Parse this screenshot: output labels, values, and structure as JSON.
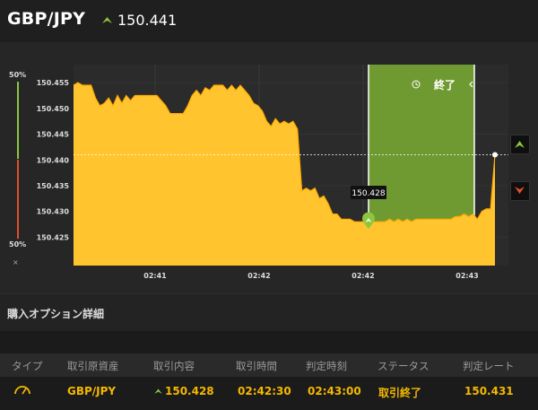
{
  "header": {
    "pair": "GBP/JPY",
    "price": "150.441",
    "trend_icon": "arrow-up-icon"
  },
  "meter": {
    "top_label": "50%",
    "bottom_label": "50%",
    "close_label": "×"
  },
  "chart": {
    "expiry_label": "終了",
    "entry_label": "150.428",
    "buttons": {
      "up_icon": "chevron-up-icon",
      "down_icon": "chevron-down-icon"
    }
  },
  "chart_data": {
    "type": "area",
    "y_ticks": [
      "150.455",
      "150.450",
      "150.445",
      "150.440",
      "150.435",
      "150.430",
      "150.425"
    ],
    "x_ticks": [
      "02:41",
      "02:42",
      "02:42",
      "02:43"
    ],
    "ylim": [
      150.4195,
      150.4585
    ],
    "current_value": 150.441,
    "entry_value": 150.428,
    "series": [
      {
        "values": [
          150.4545,
          150.455,
          150.4545,
          150.4545,
          150.4545,
          150.452,
          150.4505,
          150.451,
          150.452,
          150.4505,
          150.4525,
          150.451,
          150.4525,
          150.4515,
          150.4525,
          150.4525,
          150.4525,
          150.4525,
          150.4525,
          150.4525,
          150.4515,
          150.4505,
          150.449,
          150.449,
          150.449,
          150.449,
          150.4505,
          150.4525,
          150.4535,
          150.4525,
          150.454,
          150.4535,
          150.4545,
          150.4545,
          150.4545,
          150.4535,
          150.4545,
          150.4535,
          150.4545,
          150.4535,
          150.4525,
          150.451,
          150.4505,
          150.4495,
          150.4475,
          150.4465,
          150.448,
          150.447,
          150.4475,
          150.447,
          150.4475,
          150.446,
          150.434,
          150.4345,
          150.434,
          150.4345,
          150.4325,
          150.433,
          150.4315,
          150.4295,
          150.4295,
          150.4285,
          150.4285,
          150.4285,
          150.428,
          150.428,
          150.428,
          150.428,
          150.428,
          150.428,
          150.428,
          150.428,
          150.4285,
          150.428,
          150.4285,
          150.428,
          150.4285,
          150.428,
          150.4285,
          150.4285,
          150.4285,
          150.4285,
          150.4285,
          150.4285,
          150.4285,
          150.4285,
          150.4285,
          150.429,
          150.429,
          150.4295,
          150.429,
          150.4295,
          150.4285,
          150.43,
          150.4305,
          150.4305,
          150.441
        ]
      }
    ]
  },
  "details": {
    "title": "購入オプション詳細",
    "columns": [
      "タイプ",
      "取引原資産",
      "取引内容",
      "取引時間",
      "判定時刻",
      "ステータス",
      "判定レート"
    ],
    "row": {
      "type_icon": "gauge-icon",
      "asset": "GBP/JPY",
      "content": "150.428",
      "trade_time": "02:42:30",
      "judge_time": "02:43:00",
      "status": "取引終了",
      "rate": "150.431"
    }
  },
  "colors": {
    "area": "#ffc42e",
    "area_stroke": "#ffaa00",
    "zone": "#6f9a32",
    "up": "#8cc63f",
    "down": "#e0502b",
    "accent": "#f5b800"
  }
}
